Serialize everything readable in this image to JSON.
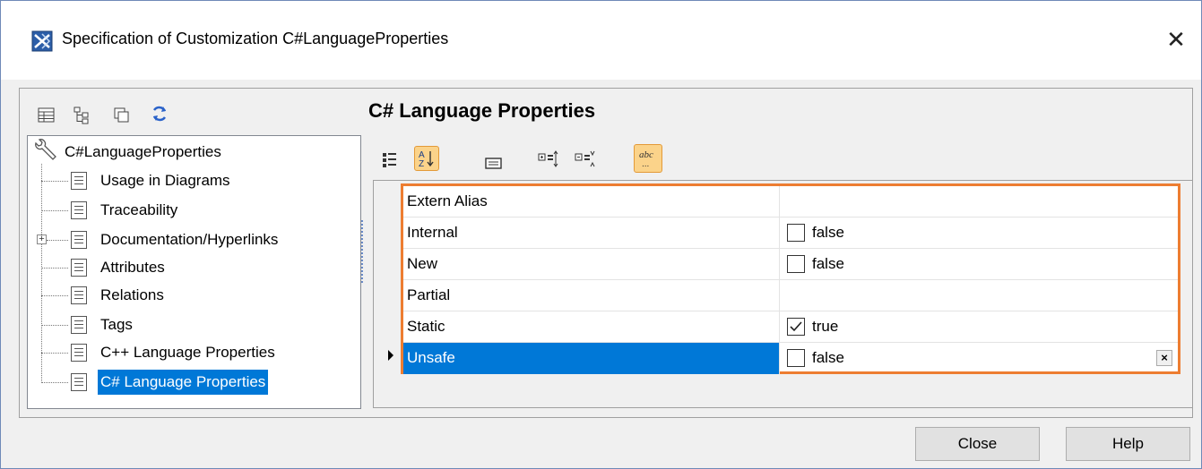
{
  "window": {
    "title": "Specification of Customization C#LanguageProperties",
    "close_glyph": "✕"
  },
  "tree": {
    "root": "C#LanguageProperties",
    "items": [
      {
        "label": "Usage in Diagrams"
      },
      {
        "label": "Traceability"
      },
      {
        "label": "Documentation/Hyperlinks"
      },
      {
        "label": "Attributes"
      },
      {
        "label": "Relations"
      },
      {
        "label": "Tags"
      },
      {
        "label": "C++ Language Properties"
      },
      {
        "label": "C# Language Properties"
      }
    ],
    "selected_index": 7
  },
  "section": {
    "title": "C# Language Properties"
  },
  "properties": {
    "rows": [
      {
        "name": "Extern Alias",
        "value": ""
      },
      {
        "name": "Internal",
        "value": "false"
      },
      {
        "name": "New",
        "value": "false"
      },
      {
        "name": "Partial",
        "value": ""
      },
      {
        "name": "Static",
        "value": "true"
      },
      {
        "name": "Unsafe",
        "value": "false"
      }
    ],
    "selected_index": 5,
    "clear_glyph": "×"
  },
  "buttons": {
    "close": "Close",
    "help": "Help"
  },
  "colors": {
    "accent": "#0078d7",
    "highlight_border": "#ed7d31",
    "toggle_active": "#fbd38a"
  }
}
